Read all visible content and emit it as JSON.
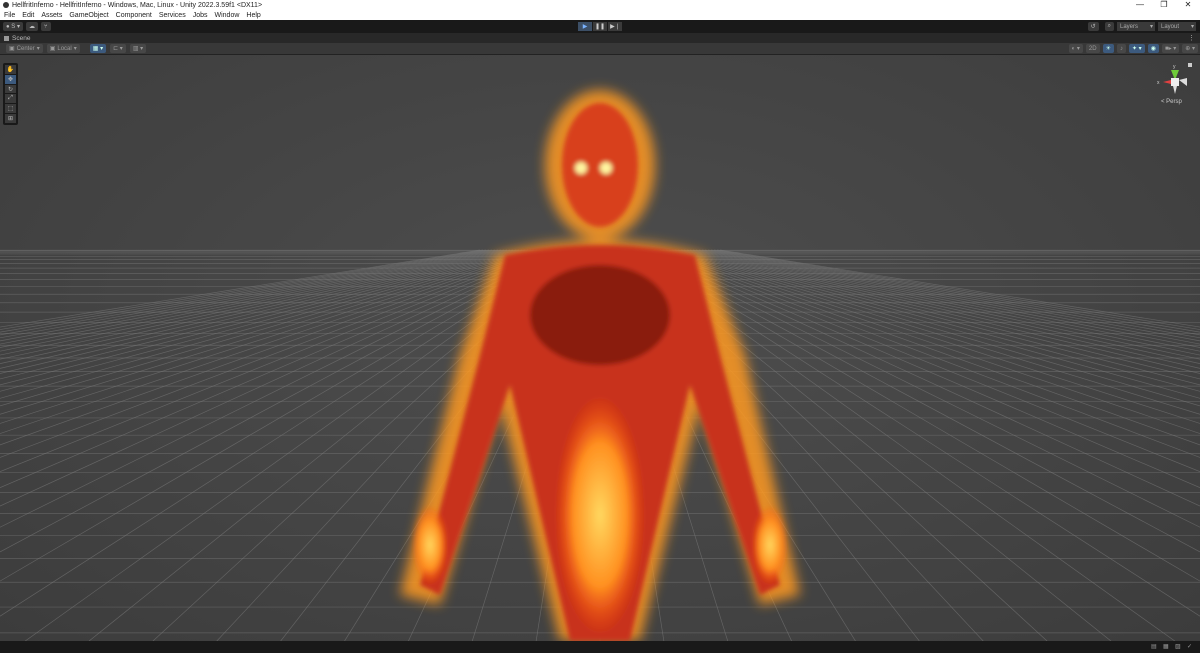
{
  "window": {
    "title": "HellfritInferno - HellfritInferno - Windows, Mac, Linux - Unity 2022.3.59f1 <DX11>",
    "controls": [
      "—",
      "❐",
      "✕"
    ]
  },
  "menu": [
    "File",
    "Edit",
    "Assets",
    "GameObject",
    "Component",
    "Services",
    "Jobs",
    "Window",
    "Help"
  ],
  "toolbar": {
    "account": "S ▾",
    "layers": "Layers",
    "layout": "Layout"
  },
  "tab": {
    "label": "Scene"
  },
  "scene_toolbar": {
    "pivot": "Center",
    "space": "Local",
    "mode_2d": "2D"
  },
  "gizmo": {
    "y_label": "y",
    "x_label": "x",
    "projection": "Persp"
  },
  "colors": {
    "accent": "#3c5a7e",
    "fire_core": "#ffd040",
    "fire_outer": "#ff4010"
  }
}
